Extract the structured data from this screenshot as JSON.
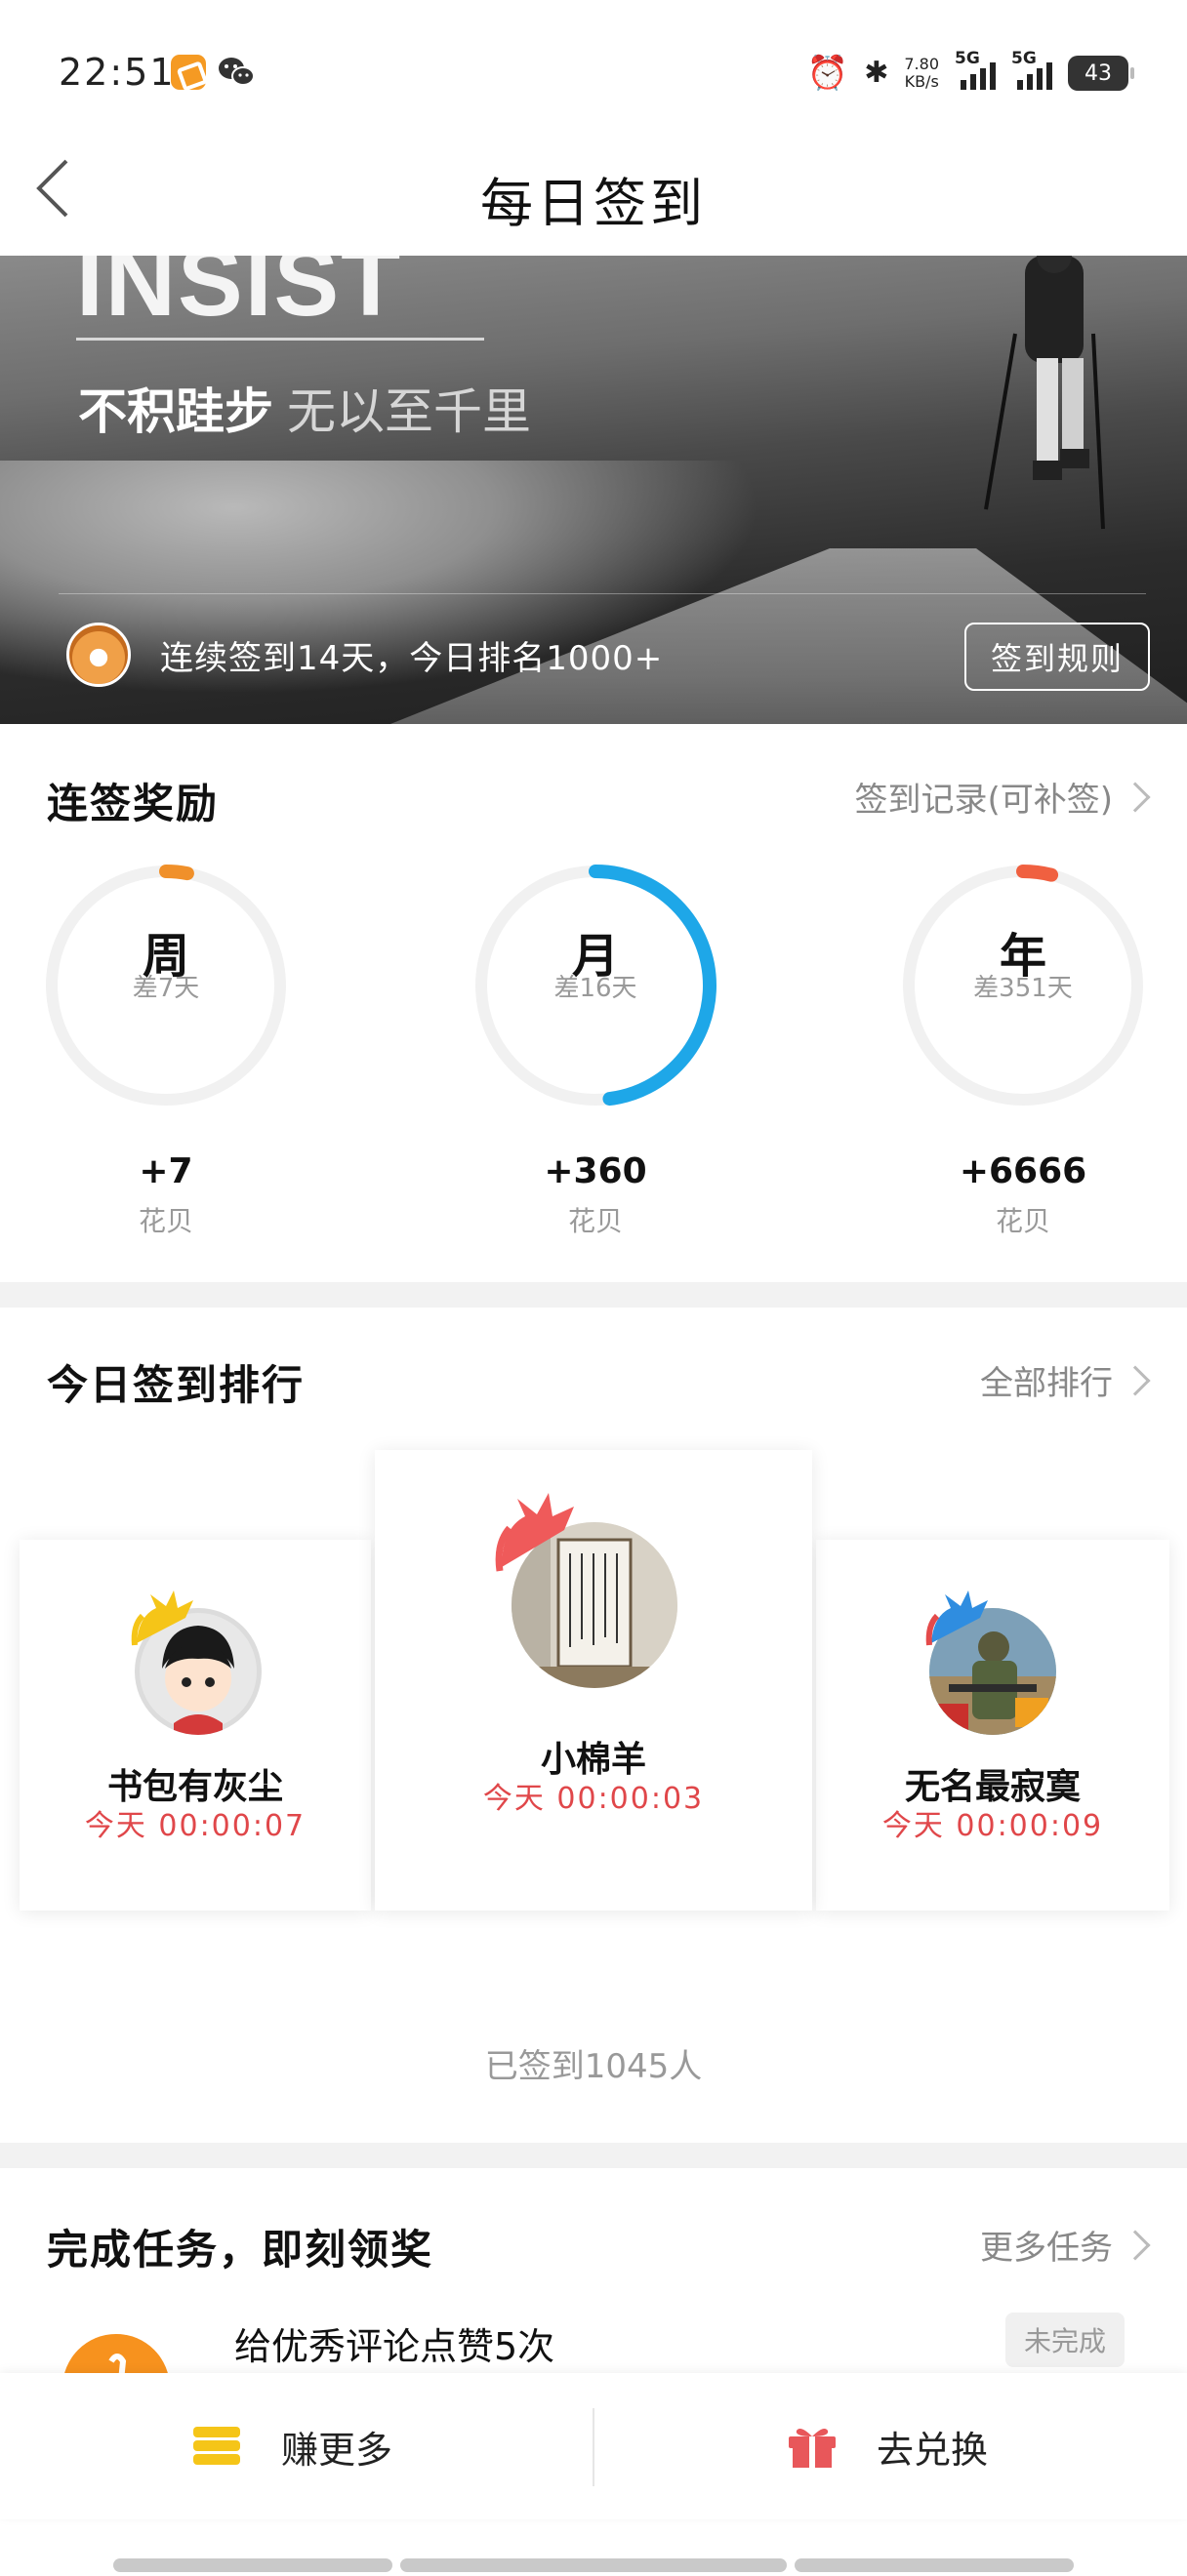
{
  "status_bar": {
    "time": "22:51",
    "net_speed_value": "7.80",
    "net_speed_unit": "KB/s",
    "sim1": "5G",
    "sim2": "5G",
    "battery": "43"
  },
  "header": {
    "title": "每日签到"
  },
  "banner": {
    "headline": "INSIST",
    "slogan_main": "不积跬步",
    "slogan_sub": "无以至千里",
    "status_text": "连续签到14天，今日排名1000+",
    "rules_label": "签到规则"
  },
  "rewards": {
    "title": "连签奖励",
    "record_link": "签到记录(可补签)",
    "items": [
      {
        "period": "周",
        "remaining": "差7天",
        "reward": "+7",
        "unit": "花贝",
        "progress": 0.03,
        "color": "#f0902a"
      },
      {
        "period": "月",
        "remaining": "差16天",
        "reward": "+360",
        "unit": "花贝",
        "progress": 0.48,
        "color": "#1ea7e8"
      },
      {
        "period": "年",
        "remaining": "差351天",
        "reward": "+6666",
        "unit": "花贝",
        "progress": 0.04,
        "color": "#f06040"
      }
    ]
  },
  "ranking": {
    "title": "今日签到排行",
    "all_link": "全部排行",
    "entries": [
      {
        "rank": 1,
        "name": "小棉羊",
        "time": "今天 00:00:03"
      },
      {
        "rank": 2,
        "name": "书包有灰尘",
        "time": "今天 00:00:07"
      },
      {
        "rank": 3,
        "name": "无名最寂寞",
        "time": "今天 00:00:09"
      }
    ],
    "signed_count": "已签到1045人"
  },
  "tasks": {
    "title": "完成任务，即刻领奖",
    "more_link": "更多任务",
    "items": [
      {
        "name": "给优秀评论点赞5次",
        "status": "未完成"
      }
    ]
  },
  "bottom_nav": {
    "earn_label": "赚更多",
    "redeem_label": "去兑换"
  },
  "colors": {
    "accent_red": "#e0474a",
    "accent_orange": "#f7921e",
    "accent_blue": "#1ea7e8",
    "coin_yellow": "#f5c518",
    "gift_red": "#e8575a"
  }
}
